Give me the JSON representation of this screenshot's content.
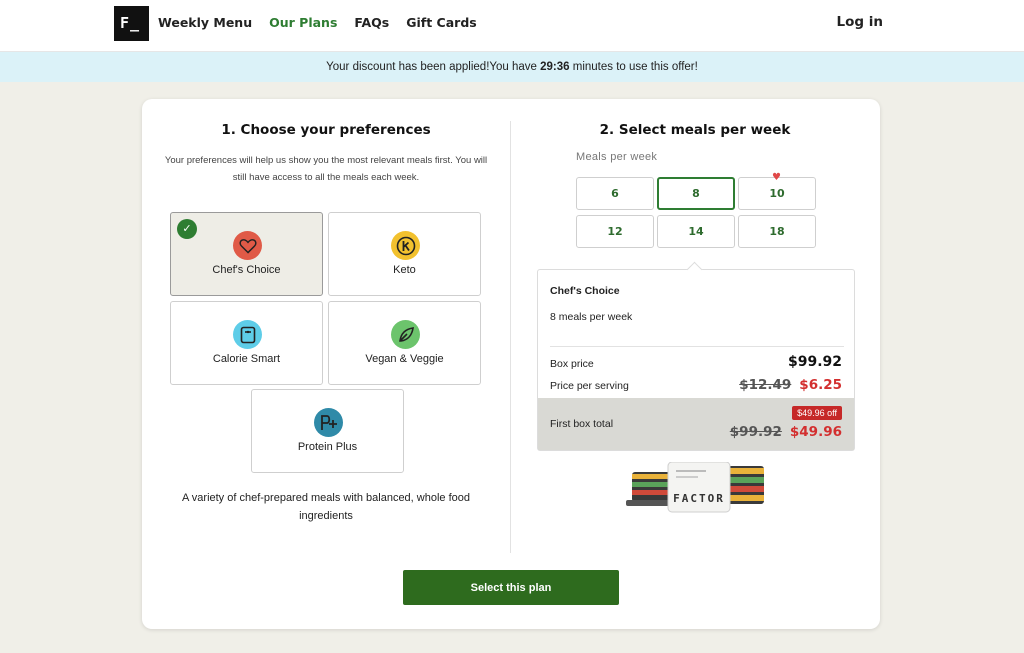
{
  "header": {
    "logo_text": "F_",
    "nav": [
      "Weekly Menu",
      "Our Plans",
      "FAQs",
      "Gift Cards"
    ],
    "login": "Log in"
  },
  "banner": {
    "prefix": "Your discount has been applied!You have ",
    "timer": "29:36",
    "suffix": " minutes to use this offer!"
  },
  "preferences": {
    "title": "1. Choose your preferences",
    "subtitle": "Your preferences will help us show you the most relevant meals first. You will still have access to all the meals each week.",
    "options": [
      {
        "label": "Chef's Choice",
        "icon": "heart-icon",
        "color": "#e05a47",
        "selected": true
      },
      {
        "label": "Keto",
        "icon": "keto-k-icon",
        "color": "#f2c12e",
        "selected": false
      },
      {
        "label": "Calorie Smart",
        "icon": "scale-icon",
        "color": "#5ecde8",
        "selected": false
      },
      {
        "label": "Vegan & Veggie",
        "icon": "leaf-icon",
        "color": "#6cc46c",
        "selected": false
      },
      {
        "label": "Protein Plus",
        "icon": "protein-plus-icon",
        "color": "#2f8aa8",
        "selected": false
      }
    ],
    "description": "A variety of chef-prepared meals with balanced, whole food ingredients"
  },
  "meals": {
    "title": "2. Select meals per week",
    "label": "Meals per week",
    "options": [
      "6",
      "8",
      "10",
      "12",
      "14",
      "18"
    ],
    "selected": "8",
    "favorite": "10"
  },
  "summary": {
    "plan": "Chef's Choice",
    "meals": "8 meals per week",
    "box_price_label": "Box price",
    "box_price": "$99.92",
    "per_serving_label": "Price per serving",
    "per_serving_old": "$12.49",
    "per_serving_new": "$6.25",
    "total_label": "First box total",
    "off_badge": "$49.96 off",
    "total_old": "$99.92",
    "total_new": "$49.96"
  },
  "product_brand": "FACTOR",
  "cta": "Select this plan",
  "colors": {
    "accent_green": "#2e7d32",
    "cta_green": "#2e6b1e",
    "price_red": "#d32f2f",
    "banner_bg": "#dbf2f8",
    "page_bg": "#f0efe8"
  }
}
